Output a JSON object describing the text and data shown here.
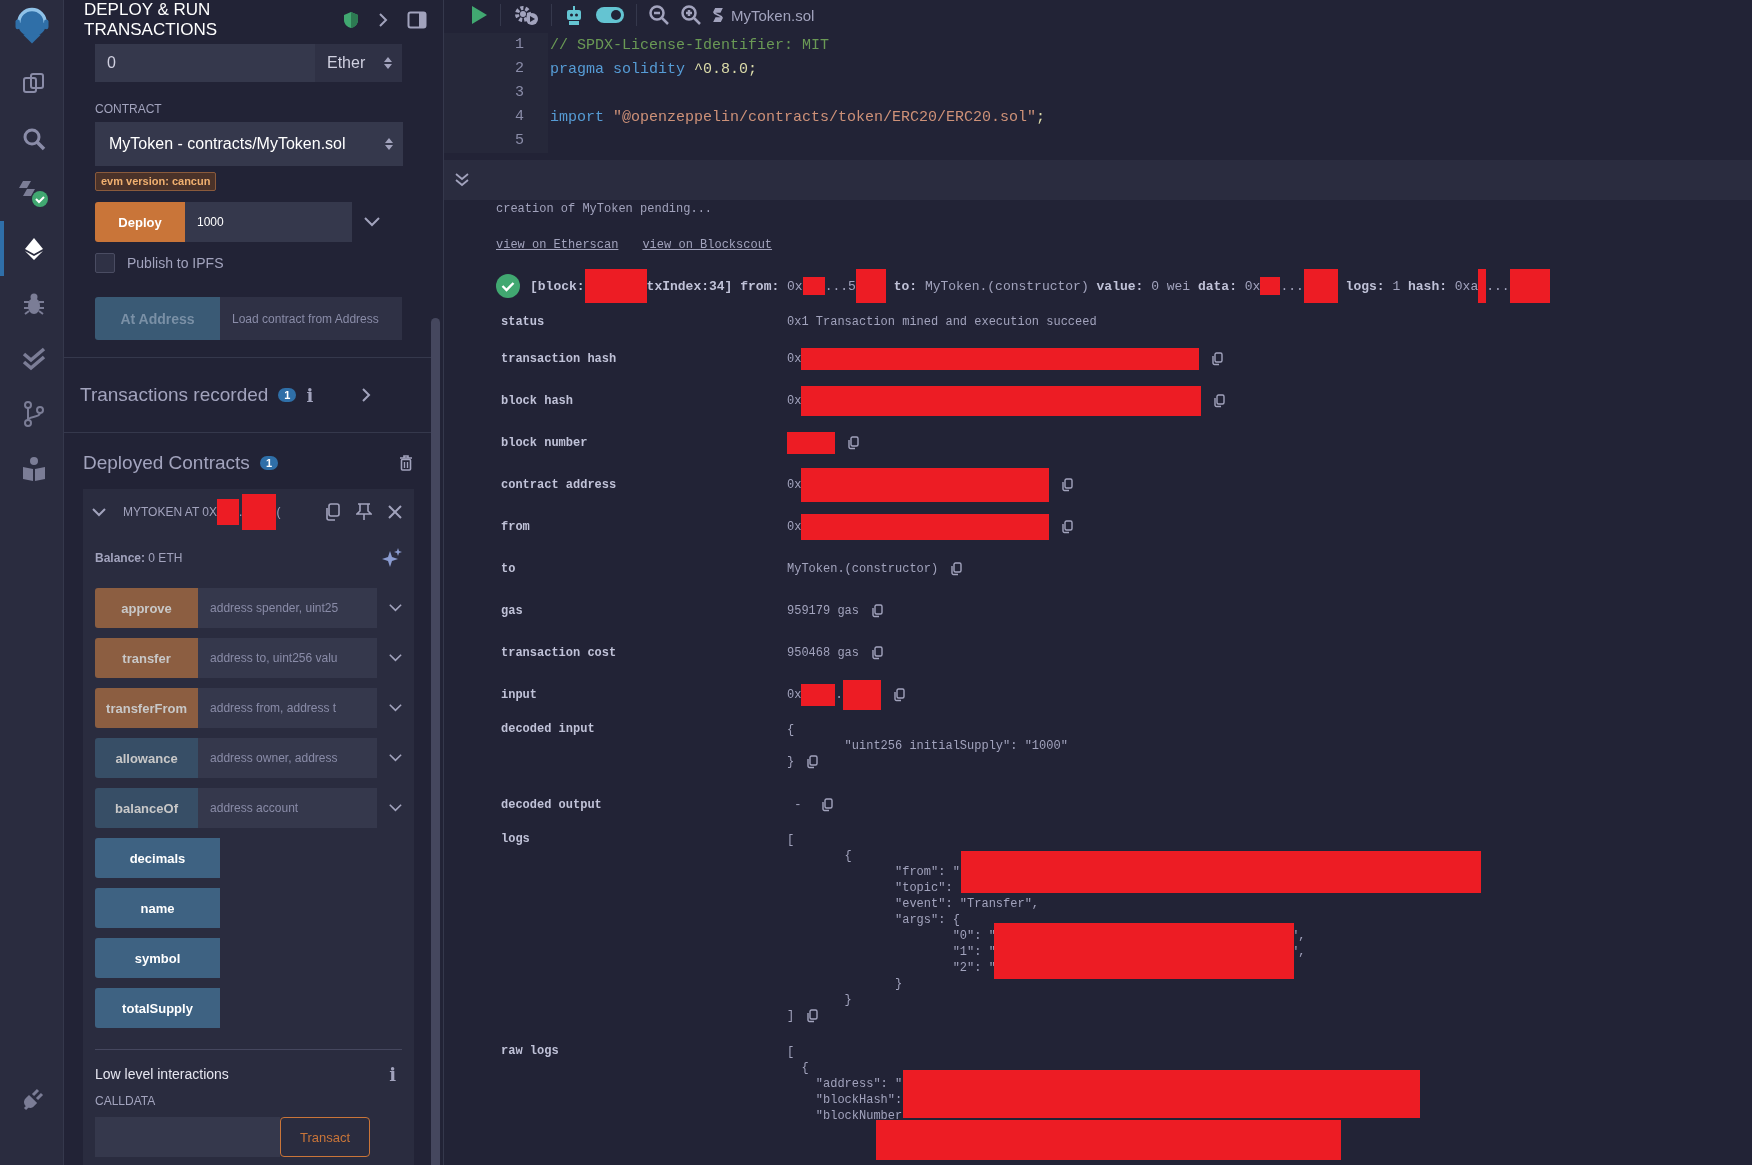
{
  "icon_bar": {
    "items": [
      {
        "kind": "file-explorer",
        "selected": false
      },
      {
        "kind": "search",
        "selected": false
      },
      {
        "kind": "compiler",
        "selected": false
      },
      {
        "kind": "deploy",
        "selected": true
      },
      {
        "kind": "debugger",
        "selected": false
      },
      {
        "kind": "tests",
        "selected": false
      },
      {
        "kind": "git",
        "selected": false
      },
      {
        "kind": "learn",
        "selected": false
      }
    ],
    "bottom_items": [
      {
        "kind": "plugin",
        "selected": false
      }
    ]
  },
  "panel": {
    "title": "DEPLOY & RUN TRANSACTIONS",
    "value_field": {
      "value": "0",
      "unit": "Ether"
    },
    "contract": {
      "label": "CONTRACT",
      "value": "MyToken - contracts/MyToken.sol"
    },
    "evm_badge": "evm version: cancun",
    "deploy": {
      "label": "Deploy",
      "value": "1000"
    },
    "publish": {
      "label": "Publish to IPFS",
      "checked": false
    },
    "at_address": {
      "label": "At Address",
      "disabled": true,
      "placeholder": "Load contract from Address"
    },
    "transactions_recorded": {
      "label": "Transactions recorded",
      "count": "1",
      "info": "i"
    },
    "deployed": {
      "label": "Deployed Contracts",
      "count": "1",
      "instance": {
        "expanded": true,
        "title": [
          {
            "kind": "text",
            "text": "MYTOKEN AT 0X"
          },
          {
            "kind": "redacted"
          },
          {
            "kind": "text",
            "text": "."
          },
          {
            "kind": "redacted"
          },
          {
            "kind": "text",
            "text": "("
          }
        ],
        "balance_label": "Balance:",
        "balance": "0 ETH",
        "functions": [
          {
            "name": "approve",
            "kind": "transact",
            "placeholder": "address spender, uint25"
          },
          {
            "name": "transfer",
            "kind": "transact",
            "placeholder": "address to, uint256 valu"
          },
          {
            "name": "transferFrom",
            "kind": "transact",
            "placeholder": "address from, address t"
          },
          {
            "name": "allowance",
            "kind": "call",
            "placeholder": "address owner, address"
          },
          {
            "name": "balanceOf",
            "kind": "call",
            "placeholder": "address account"
          },
          {
            "name": "decimals",
            "kind": "call"
          },
          {
            "name": "name",
            "kind": "call"
          },
          {
            "name": "symbol",
            "kind": "call"
          },
          {
            "name": "totalSupply",
            "kind": "call"
          }
        ],
        "low_level": {
          "title": "Low level interactions",
          "info": "i",
          "calldata_label": "CALLDATA",
          "button": "Transact"
        }
      }
    }
  },
  "main": {
    "toolbar": {
      "file": "MyToken.sol",
      "toggle_on": true
    },
    "editor": {
      "lines": [
        {
          "number": "1",
          "tokens": [
            {
              "kind": "comment",
              "text": "// SPDX-License-Identifier: MIT"
            }
          ]
        },
        {
          "number": "2",
          "tokens": [
            {
              "kind": "keyword",
              "text": "pragma solidity"
            },
            {
              "kind": "plain",
              "text": " ^0.8.0;"
            }
          ]
        },
        {
          "number": "3"
        },
        {
          "number": "4",
          "tokens": [
            {
              "kind": "keyword",
              "text": "import"
            },
            {
              "kind": "string",
              "text": " \"@openzeppelin/contracts/token/ERC20/ERC20.sol\""
            },
            {
              "kind": "plain",
              "text": ";"
            }
          ]
        },
        {
          "number": "5"
        }
      ]
    },
    "terminal": {
      "pending": "creation of MyToken pending...",
      "links": [
        "view on Etherscan",
        "view on Blockscout"
      ],
      "tx_line": [
        {
          "kind": "key",
          "text": "[block:"
        },
        {
          "kind": "redacted"
        },
        {
          "kind": "key",
          "text": "txIndex:34]"
        },
        {
          "kind": "key",
          "text": " from:"
        },
        {
          "kind": "text",
          "text": " 0x"
        },
        {
          "kind": "redacted"
        },
        {
          "kind": "text",
          "text": "...5"
        },
        {
          "kind": "redacted"
        },
        {
          "kind": "key",
          "text": " to:"
        },
        {
          "kind": "text",
          "text": " MyToken.(constructor) "
        },
        {
          "kind": "key",
          "text": "value:"
        },
        {
          "kind": "text",
          "text": " 0 wei "
        },
        {
          "kind": "key",
          "text": "data:"
        },
        {
          "kind": "text",
          "text": " 0x"
        },
        {
          "kind": "redacted"
        },
        {
          "kind": "text",
          "text": "..."
        },
        {
          "kind": "redacted"
        },
        {
          "kind": "key",
          "text": " logs:"
        },
        {
          "kind": "text",
          "text": " 1 "
        },
        {
          "kind": "key",
          "text": "hash:"
        },
        {
          "kind": "text",
          "text": " 0xa"
        },
        {
          "kind": "redacted"
        },
        {
          "kind": "text",
          "text": "..."
        },
        {
          "kind": "redacted"
        }
      ],
      "rows": [
        {
          "label": "status",
          "value": [
            {
              "kind": "text",
              "text": "0x1 Transaction mined and execution succeed"
            }
          ],
          "copy": false
        },
        {
          "label": "transaction hash",
          "value": [
            {
              "kind": "text",
              "text": "0x"
            },
            {
              "kind": "redacted"
            }
          ],
          "copy": true
        },
        {
          "label": "block hash",
          "value": [
            {
              "kind": "text",
              "text": "0x"
            },
            {
              "kind": "redacted"
            }
          ],
          "copy": true
        },
        {
          "label": "block number",
          "value": [
            {
              "kind": "redacted"
            }
          ],
          "copy": true
        },
        {
          "label": "contract address",
          "value": [
            {
              "kind": "text",
              "text": "0x"
            },
            {
              "kind": "redacted"
            }
          ],
          "copy": true
        },
        {
          "label": "from",
          "value": [
            {
              "kind": "text",
              "text": "0x"
            },
            {
              "kind": "redacted"
            }
          ],
          "copy": true
        },
        {
          "label": "to",
          "value": [
            {
              "kind": "text",
              "text": "MyToken.(constructor)"
            }
          ],
          "copy": true
        },
        {
          "label": "gas",
          "value": [
            {
              "kind": "text",
              "text": "959179 gas"
            }
          ],
          "copy": true
        },
        {
          "label": "transaction cost",
          "value": [
            {
              "kind": "text",
              "text": "950468 gas"
            }
          ],
          "copy": true
        },
        {
          "label": "input",
          "value": [
            {
              "kind": "text",
              "text": "0x"
            },
            {
              "kind": "redacted"
            },
            {
              "kind": "text",
              "text": "."
            },
            {
              "kind": "redacted"
            }
          ],
          "copy": true
        },
        {
          "label": "decoded input",
          "lines": [
            "{",
            "        \"uint256 initialSupply\": \"1000\"",
            "}"
          ],
          "copy": true
        },
        {
          "label": "decoded output",
          "value": [
            {
              "kind": "text",
              "text": " - "
            }
          ],
          "copy": true
        },
        {
          "label": "logs",
          "lines": [
            "[",
            "        {",
            "               \"from\": \"",
            "               \"topic\":",
            "               \"event\": \"Transfer\",",
            "               \"args\": {",
            "                       \"0\": \"                                         \",",
            "                       \"1\": \"                                         \",",
            "                       \"2\": \"",
            "               }",
            "        }",
            "]"
          ],
          "copy": true
        },
        {
          "label": "raw logs",
          "lines": [
            "[",
            "  {",
            "    \"address\": \"",
            "    \"blockHash\":",
            "    \"blockNumber"
          ],
          "copy": false
        }
      ]
    }
  }
}
